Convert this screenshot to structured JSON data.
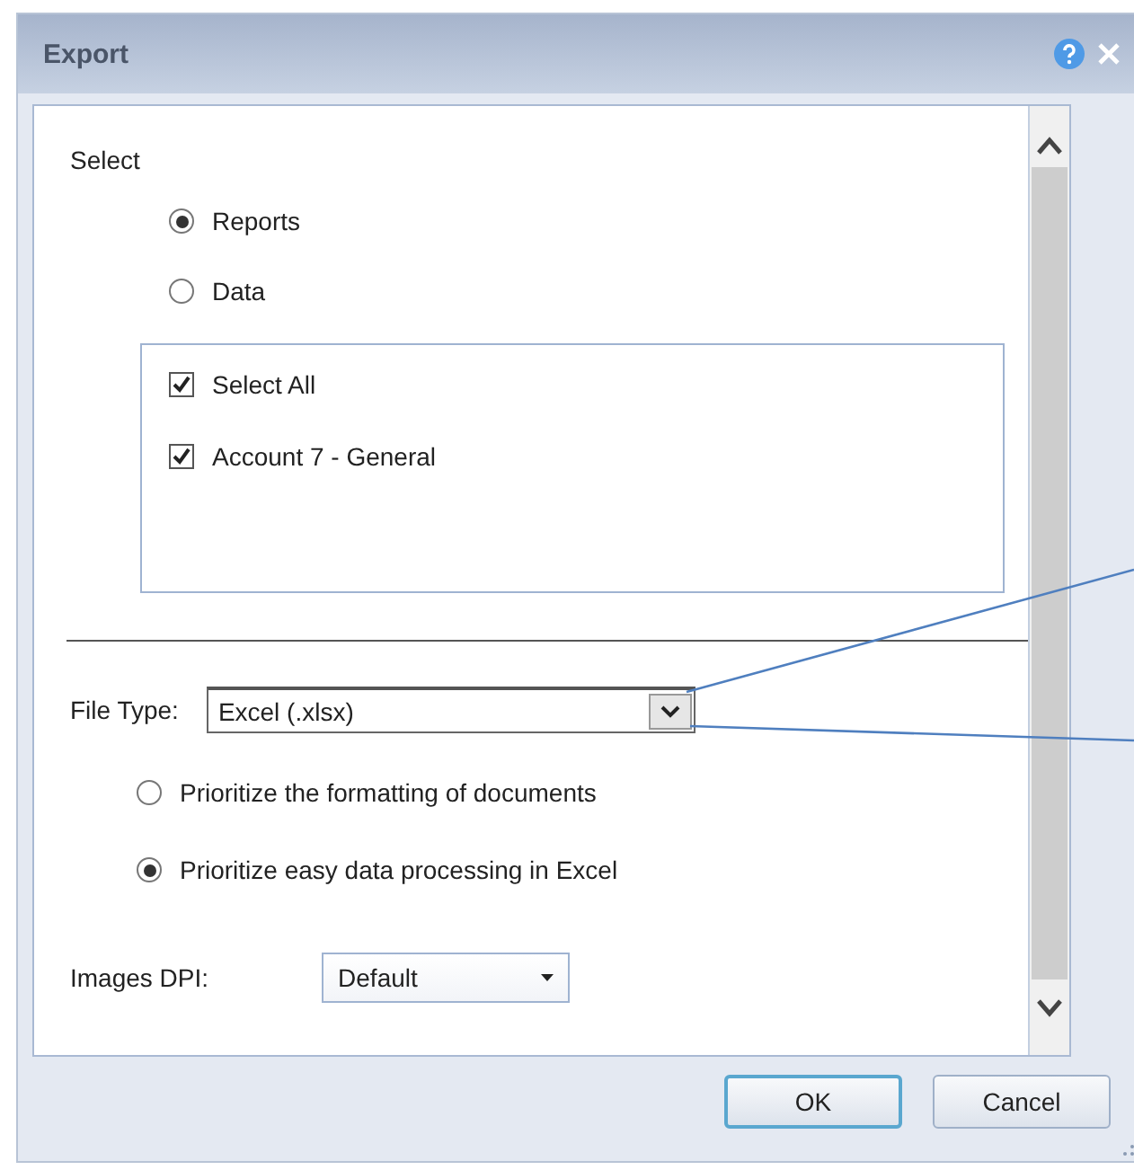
{
  "dialog": {
    "title": "Export"
  },
  "select_section": {
    "label": "Select",
    "options": [
      {
        "label": "Reports",
        "selected": true
      },
      {
        "label": "Data",
        "selected": false
      }
    ],
    "items": [
      {
        "label": "Select All",
        "checked": true
      },
      {
        "label": "Account 7 - General",
        "checked": true
      }
    ]
  },
  "file_type": {
    "label": "File Type:",
    "value": "Excel (.xlsx)"
  },
  "formatting_options": [
    {
      "label": "Prioritize the formatting of documents",
      "selected": false
    },
    {
      "label": "Prioritize easy data processing in Excel",
      "selected": true
    }
  ],
  "images_dpi": {
    "label": "Images DPI:",
    "value": "Default"
  },
  "buttons": [
    {
      "label": "OK",
      "kind": "primary"
    },
    {
      "label": "Cancel",
      "kind": "secondary"
    }
  ]
}
